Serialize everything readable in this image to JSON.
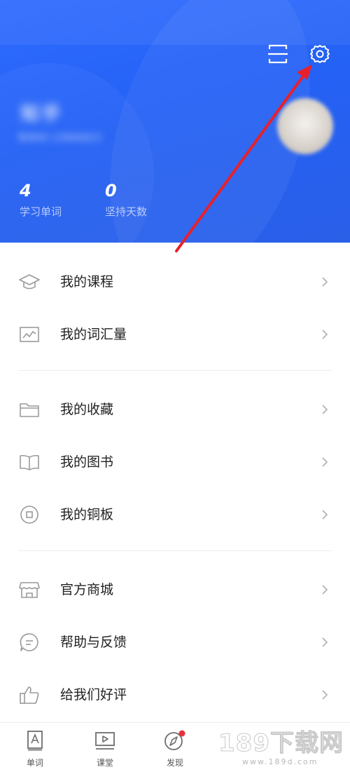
{
  "header": {
    "username": "知乎",
    "user_id": "知米ID 13966823",
    "stats": [
      {
        "value": "4",
        "label": "学习单词"
      },
      {
        "value": "0",
        "label": "坚持天数"
      }
    ],
    "icons": {
      "scan": "scan-icon",
      "settings": "gear-icon"
    },
    "accent_color": "#2563f0",
    "annotation_arrow_color": "#e8202a"
  },
  "menu": {
    "groups": [
      [
        {
          "label": "我的课程",
          "icon": "graduation-cap-icon"
        },
        {
          "label": "我的词汇量",
          "icon": "chart-icon"
        }
      ],
      [
        {
          "label": "我的收藏",
          "icon": "folder-icon"
        },
        {
          "label": "我的图书",
          "icon": "book-icon"
        },
        {
          "label": "我的铜板",
          "icon": "coin-icon"
        }
      ],
      [
        {
          "label": "官方商城",
          "icon": "shop-icon"
        },
        {
          "label": "帮助与反馈",
          "icon": "chat-bubble-icon"
        },
        {
          "label": "给我们好评",
          "icon": "thumbs-up-icon"
        }
      ]
    ]
  },
  "tabbar": {
    "tabs": [
      {
        "label": "单词",
        "icon": "word-card-icon"
      },
      {
        "label": "课堂",
        "icon": "video-icon"
      },
      {
        "label": "发现",
        "icon": "compass-icon",
        "badge": true
      }
    ]
  },
  "watermark": {
    "main": "189下载网",
    "sub": "www.189d.com"
  }
}
